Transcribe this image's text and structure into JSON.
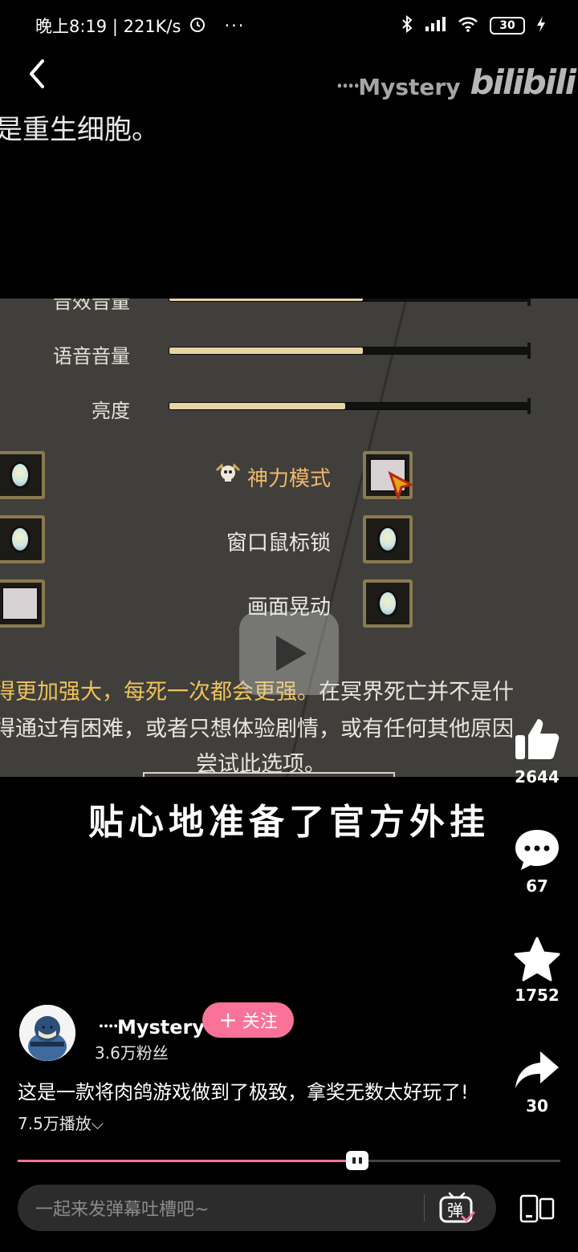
{
  "status_bar": {
    "time_speed": "晚上8:19 | 221K/s",
    "more": "···",
    "battery": "30"
  },
  "watermark": {
    "author": "᠁Mystery",
    "logo": "bilibili"
  },
  "caption_top": "是重生细胞。",
  "video_frame": {
    "setting_rows": [
      {
        "label": "音效音量",
        "level": 0.54
      },
      {
        "label": "语音音量",
        "level": 0.54
      },
      {
        "label": "亮度",
        "level": 0.49
      }
    ],
    "options": [
      {
        "label": "神力模式",
        "state": "off-cursor"
      },
      {
        "label": "窗口鼠标锁",
        "state": "on"
      },
      {
        "label": "画面晃动",
        "state": "on"
      }
    ],
    "desc_line1_highlight": "得更加强大，每死一次都会更强。",
    "desc_line1_rest": "在冥界死亡并不是什",
    "desc_line2": "得通过有困难，或者只想体验剧情，或有任何其他原因",
    "desc_line3": "尝试此选项。"
  },
  "subtitle": "贴心地准备了官方外挂",
  "actions": {
    "like_count": "2644",
    "comment_count": "67",
    "favorite_count": "1752",
    "share_count": "30"
  },
  "author": {
    "name": "᠁Mystery",
    "fans": "3.6万粉丝",
    "follow_label": "关注",
    "follow_plus": "+"
  },
  "description": {
    "text": "这是一款将肉鸽游戏做到了极致，拿奖无数太好玩了!",
    "plays": "7.5万播放",
    "expand": "⌵"
  },
  "progress": {
    "fraction": 0.625
  },
  "danmaku": {
    "placeholder": "一起来发弹幕吐槽吧~",
    "toggle_label": "弹"
  },
  "colors": {
    "accent": "#fb7299",
    "slider_fill": "#e7d3a4",
    "highlight_text": "#f0c25a"
  }
}
